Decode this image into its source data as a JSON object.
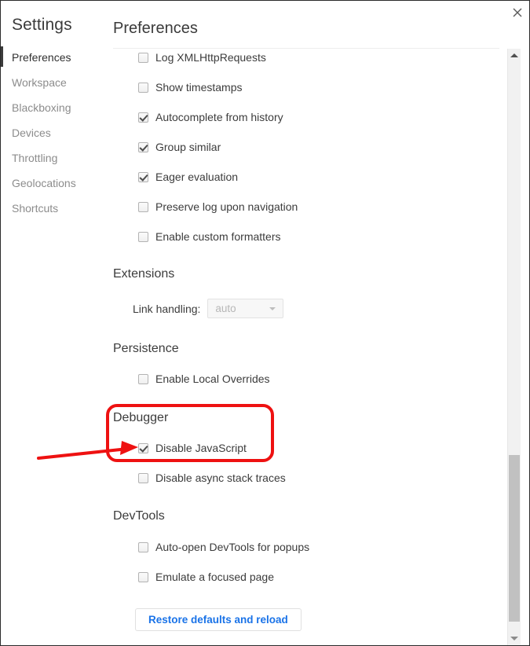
{
  "window": {
    "close_icon": "close-icon"
  },
  "sidebar": {
    "title": "Settings",
    "items": [
      {
        "label": "Preferences",
        "selected": true
      },
      {
        "label": "Workspace",
        "selected": false
      },
      {
        "label": "Blackboxing",
        "selected": false
      },
      {
        "label": "Devices",
        "selected": false
      },
      {
        "label": "Throttling",
        "selected": false
      },
      {
        "label": "Geolocations",
        "selected": false
      },
      {
        "label": "Shortcuts",
        "selected": false
      }
    ]
  },
  "main": {
    "title": "Preferences",
    "console_options": [
      {
        "label": "Log XMLHttpRequests",
        "checked": false
      },
      {
        "label": "Show timestamps",
        "checked": false
      },
      {
        "label": "Autocomplete from history",
        "checked": true
      },
      {
        "label": "Group similar",
        "checked": true
      },
      {
        "label": "Eager evaluation",
        "checked": true
      },
      {
        "label": "Preserve log upon navigation",
        "checked": false
      },
      {
        "label": "Enable custom formatters",
        "checked": false
      }
    ],
    "extensions": {
      "heading": "Extensions",
      "link_handling_label": "Link handling:",
      "link_handling_value": "auto"
    },
    "persistence": {
      "heading": "Persistence",
      "options": [
        {
          "label": "Enable Local Overrides",
          "checked": false
        }
      ]
    },
    "debugger": {
      "heading": "Debugger",
      "options": [
        {
          "label": "Disable JavaScript",
          "checked": true
        },
        {
          "label": "Disable async stack traces",
          "checked": false
        }
      ]
    },
    "devtools": {
      "heading": "DevTools",
      "options": [
        {
          "label": "Auto-open DevTools for popups",
          "checked": false
        },
        {
          "label": "Emulate a focused page",
          "checked": false
        }
      ]
    },
    "restore_button_label": "Restore defaults and reload"
  },
  "annotation": {
    "highlight_color": "#ee1111",
    "arrow_color": "#ee1111"
  }
}
